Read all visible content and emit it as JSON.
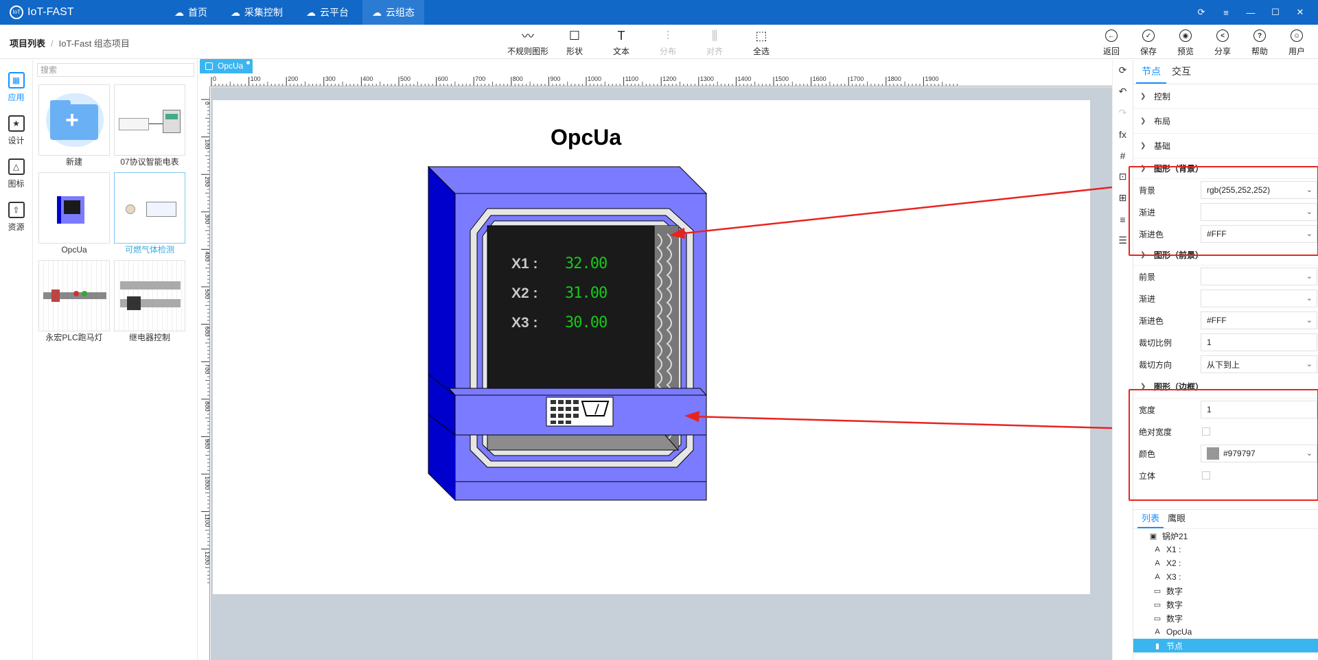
{
  "app": {
    "title": "IoT-FAST"
  },
  "nav": [
    {
      "label": "首页",
      "icon": "home-icon"
    },
    {
      "label": "采集控制",
      "icon": "cloud-sync-icon"
    },
    {
      "label": "云平台",
      "icon": "cloud-platform-icon"
    },
    {
      "label": "云组态",
      "icon": "cloud-config-icon",
      "active": true
    }
  ],
  "breadcrumb": {
    "root": "项目列表",
    "sep": "/",
    "current": "IoT-Fast 组态项目"
  },
  "toolbar": [
    {
      "label": "不规则图形",
      "icon": "wave-icon",
      "disabled": false
    },
    {
      "label": "形状",
      "icon": "square-icon",
      "disabled": false
    },
    {
      "label": "文本",
      "icon": "text-icon",
      "disabled": false
    },
    {
      "label": "分布",
      "icon": "distribute-icon",
      "disabled": true
    },
    {
      "label": "对齐",
      "icon": "align-icon",
      "disabled": true
    },
    {
      "label": "全选",
      "icon": "select-all-icon",
      "disabled": false
    }
  ],
  "righttools": [
    {
      "label": "返回",
      "glyph": "←"
    },
    {
      "label": "保存",
      "glyph": "✓"
    },
    {
      "label": "预览",
      "glyph": "◉"
    },
    {
      "label": "分享",
      "glyph": "<"
    },
    {
      "label": "帮助",
      "glyph": "?"
    },
    {
      "label": "用户",
      "glyph": "☺"
    }
  ],
  "leftnav": [
    {
      "label": "应用",
      "glyph": "▦",
      "active": true
    },
    {
      "label": "设计",
      "glyph": "★"
    },
    {
      "label": "图标",
      "glyph": "△"
    },
    {
      "label": "资源",
      "glyph": "⇧"
    }
  ],
  "library": {
    "search_placeholder": "搜索",
    "items": [
      {
        "label": "新建"
      },
      {
        "label": "07协议智能电表"
      },
      {
        "label": "OpcUa"
      },
      {
        "label": "可燃气体检测",
        "selected": true
      },
      {
        "label": "永宏PLC跑马灯"
      },
      {
        "label": "继电器控制"
      }
    ]
  },
  "doc_tab": "OpcUa",
  "ruler": {
    "h": [
      "0",
      "100",
      "200",
      "300",
      "400",
      "500",
      "600",
      "700",
      "800",
      "900",
      "1000",
      "1100",
      "1200",
      "1300",
      "1400",
      "1500",
      "1600",
      "1700",
      "1800",
      "1900"
    ],
    "v": [
      "0",
      "100",
      "200",
      "300",
      "400",
      "500",
      "600",
      "700",
      "800",
      "900",
      "1000",
      "1100",
      "1200"
    ]
  },
  "canvas": {
    "title": "OpcUa",
    "readings": [
      {
        "label": "X1 :",
        "value": "32.00"
      },
      {
        "label": "X2 :",
        "value": "31.00"
      },
      {
        "label": "X3 :",
        "value": "30.00"
      }
    ],
    "colors": {
      "body": "#7b7bff",
      "side": "#0000cc",
      "screen": "#1a1a1a",
      "digits": "#16c91a",
      "arrow": "#e8231f"
    }
  },
  "sidetools": [
    "⟳",
    "↶",
    "↷",
    "fx",
    "#",
    "⊡",
    "⊞",
    "≡",
    "☰"
  ],
  "props": {
    "tabs": [
      "节点",
      "交互"
    ],
    "collapsed": [
      "控制",
      "布局",
      "基础"
    ],
    "background": {
      "title": "图形（背景）",
      "rows": [
        {
          "label": "背景",
          "value": "rgb(255,252,252)"
        },
        {
          "label": "渐进",
          "value": ""
        },
        {
          "label": "渐进色",
          "value": "#FFF"
        }
      ]
    },
    "foreground": {
      "title": "图形（前景）",
      "rows": [
        {
          "label": "前景",
          "value": ""
        },
        {
          "label": "渐进",
          "value": ""
        },
        {
          "label": "渐进色",
          "value": "#FFF"
        },
        {
          "label": "裁切比例",
          "value": "1"
        },
        {
          "label": "裁切方向",
          "value": "从下到上"
        }
      ]
    },
    "border": {
      "title": "图形（边框）",
      "width_label": "宽度",
      "width_value": "1",
      "abs_label": "绝对宽度",
      "color_label": "颜色",
      "color_value": "#979797",
      "solid_label": "立体"
    }
  },
  "layers": {
    "tabs": [
      "列表",
      "鹰眼"
    ],
    "items": [
      {
        "label": "锅炉21",
        "icon": "▣"
      },
      {
        "label": "X1 :",
        "icon": "A"
      },
      {
        "label": "X2 :",
        "icon": "A"
      },
      {
        "label": "X3 :",
        "icon": "A"
      },
      {
        "label": "数字",
        "icon": "▭"
      },
      {
        "label": "数字",
        "icon": "▭"
      },
      {
        "label": "数字",
        "icon": "▭"
      },
      {
        "label": "OpcUa",
        "icon": "A"
      },
      {
        "label": "节点",
        "icon": "▮",
        "selected": true
      }
    ]
  }
}
